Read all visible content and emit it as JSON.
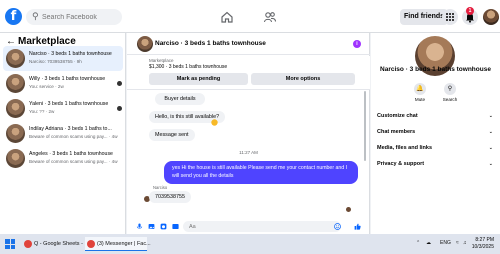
{
  "top": {
    "search_placeholder": "Search Facebook",
    "find_friends": "Find friends",
    "notif_count": "1"
  },
  "sidebar": {
    "title": "Marketplace",
    "items": [
      {
        "title": "Narciso · 3 beds 1 baths townhouse",
        "sub": "Narciso: 7039538755 · 9h"
      },
      {
        "title": "Willy · 3 beds 1 baths townhouse",
        "sub": "You: service · 2w"
      },
      {
        "title": "Yaleni · 3 beds 1 baths townhouse",
        "sub": "You: ?? · 2w"
      },
      {
        "title": "Indilay Adriana · 3 beds 1 baths to...",
        "sub": "Beware of common scams using pay... · 4w"
      },
      {
        "title": "Angeles · 3 beds 1 baths townhouse",
        "sub": "Beware of common scams using pay... · 4w"
      }
    ]
  },
  "chat": {
    "header_name": "Narciso · 3 beds 1 baths townhouse",
    "listing_kind": "Marketplace",
    "listing_price": "$1,300 · 3 beds 1 baths townhouse",
    "mark_pending": "Mark as pending",
    "more_options": "More options",
    "msg_buyer_details": "Buyer details",
    "msg_still_available": "Hello, is this still available?",
    "msg_sent": "Message sent",
    "timestamp": "11:27 AM",
    "msg_out": "yes Hi the house is still available Please send me your contact number and I will send you all the details",
    "sender_label": "Narciso",
    "msg_reply": "7039538755",
    "composer_placeholder": "Aa"
  },
  "info": {
    "name": "Narciso · 3 beds 1 baths townhouse",
    "mute": "Mute",
    "search": "Search",
    "sections": [
      "Customize chat",
      "Chat members",
      "Media, files and links",
      "Privacy & support"
    ]
  },
  "taskbar": {
    "item1": "Q - Google Sheets - ...",
    "item2": "(3) Messenger | Fac...",
    "lang": "ENG",
    "time": "8:27 PM",
    "date": "10/3/2025"
  },
  "colors": {
    "fb_blue": "#1877f2",
    "outgoing_bubble": "#4f44ff",
    "info_purple": "#a033ff"
  }
}
